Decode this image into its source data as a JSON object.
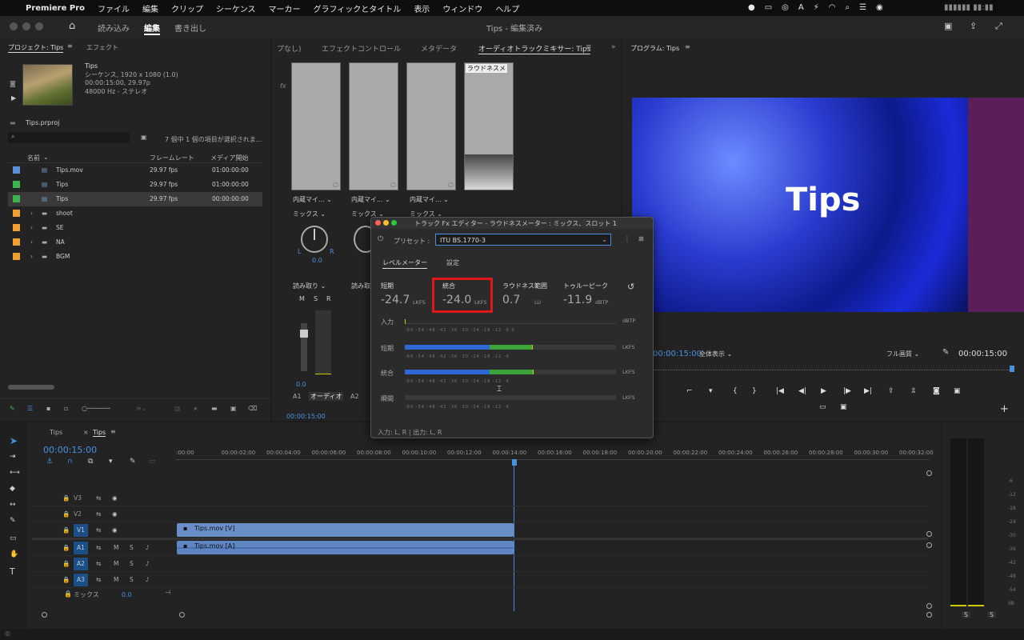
{
  "menubar": {
    "app": "Premiere Pro",
    "items": [
      "ファイル",
      "編集",
      "クリップ",
      "シーケンス",
      "マーカー",
      "グラフィックとタイトル",
      "表示",
      "ウィンドウ",
      "ヘルプ"
    ],
    "clock": "▮▮▮▮▮▮ ▮▮:▮▮"
  },
  "header": {
    "tabs": [
      "読み込み",
      "編集",
      "書き出し"
    ],
    "title": "Tips - 編集済み"
  },
  "project": {
    "tab": "プロジェクト: Tips",
    "tab2": "エフェクト",
    "clip_name": "Tips",
    "clip_info1": "シーケンス, 1920 x 1080 (1.0)",
    "clip_info2": "00:00:15:00, 29.97p",
    "clip_info3": "48000 Hz - ステレオ",
    "file": "Tips.prproj",
    "count": "7 個中 1 個の項目が選択されま...",
    "col_name": "名前",
    "col_fps": "フレームレート",
    "col_start": "メディア開始",
    "rows": [
      {
        "name": "Tips.mov",
        "fps": "29.97 fps",
        "start": "01:00:00:00",
        "color": "#5b8fd8"
      },
      {
        "name": "Tips",
        "fps": "29.97 fps",
        "start": "01:00:00:00",
        "color": "#3cb44b"
      },
      {
        "name": "Tips",
        "fps": "29.97 fps",
        "start": "00:00:00:00",
        "color": "#3cb44b"
      },
      {
        "name": "shoot",
        "fps": "",
        "start": "",
        "color": "#f0a030"
      },
      {
        "name": "SE",
        "fps": "",
        "start": "",
        "color": "#f0a030"
      },
      {
        "name": "NA",
        "fps": "",
        "start": "",
        "color": "#f0a030"
      },
      {
        "name": "BGM",
        "fps": "",
        "start": "",
        "color": "#f0a030"
      }
    ]
  },
  "mixer": {
    "tab0": "プなし)",
    "tab1": "エフェクトコントロール",
    "tab2": "メタデータ",
    "tab3": "オーディオトラックミキサー: Tips",
    "loud_label": "ラウドネスメ",
    "input1": "内蔵マイ...",
    "input2": "内蔵マイ...",
    "input3": "内蔵マイ...",
    "out1": "ミックス",
    "out2": "ミックス",
    "out3": "ミックス",
    "pan_val": "0.0",
    "auto1": "読み取り",
    "auto2": "読み取",
    "m": "M",
    "s": "S",
    "r": "R",
    "vol": "0.0",
    "a1": "A1",
    "a1name": "オーディオ",
    "a2": "A2",
    "tc": "00:00:15:00",
    "fx": "fx"
  },
  "program": {
    "tab": "プログラム: Tips",
    "overlay": "Tips",
    "tc_left": "00:00:15:00",
    "tc_right": "00:00:15:00",
    "zoom": "全体表示",
    "quality": "フル画質"
  },
  "dialog": {
    "title": "トラック Fx エディター - ラウドネスメーター : ミックス、スロット 1",
    "preset_label": "プリセット :",
    "preset": "ITU BS.1770-3",
    "tab_meter": "レベルメーター",
    "tab_settings": "設定",
    "short_label": "短期",
    "short_val": "-24.7",
    "short_unit": "LKFS",
    "int_label": "統合",
    "int_val": "-24.0",
    "int_unit": "LKFS",
    "range_label": "ラウドネス範囲",
    "range_val": "0.7",
    "range_unit": "LU",
    "peak_label": "トゥルーピーク",
    "peak_val": "-11.9",
    "peak_unit": "dBTP",
    "row_input": "入力",
    "row_short": "短期",
    "row_int": "統合",
    "row_mom": "瞬間",
    "u_dbtp": "dBTP",
    "u_lkfs": "LKFS",
    "scale": "-60 -54 -48 -42 -36 -30 -24 -18 -12 -6 0",
    "scale2": "-60 -54 -48 -42 -36 -30 -24 -18 -12 -6",
    "footer": "入力: L, R | 出力: L, R",
    "short_level": -23.8,
    "int_level": -23.6
  },
  "timeline": {
    "tab1": "Tips",
    "tab2": "Tips",
    "tc": "00:00:15:00",
    "ruler": [
      ":00:00",
      "00:00:02:00",
      "00:00:04:00",
      "00:00:06:00",
      "00:00:08:00",
      "00:00:10:00",
      "00:00:12:00",
      "00:00:14:00",
      "00:00:16:00",
      "00:00:18:00",
      "00:00:20:00",
      "00:00:22:00",
      "00:00:24:00",
      "00:00:26:00",
      "00:00:28:00",
      "00:00:30:00",
      "00:00:32:00"
    ],
    "tracks": [
      "V3",
      "V2",
      "V1",
      "A1",
      "A2",
      "A3"
    ],
    "mix": "ミックス",
    "mix_val": "0.0",
    "clip_v": "Tips.mov [V]",
    "clip_a": "Tips.mov [A]",
    "m": "M",
    "s": "S"
  },
  "meters": {
    "scale": [
      "-6",
      "-12",
      "-18",
      "-24",
      "-30",
      "-36",
      "-42",
      "-48",
      "-54",
      "dB"
    ],
    "s": "S"
  }
}
